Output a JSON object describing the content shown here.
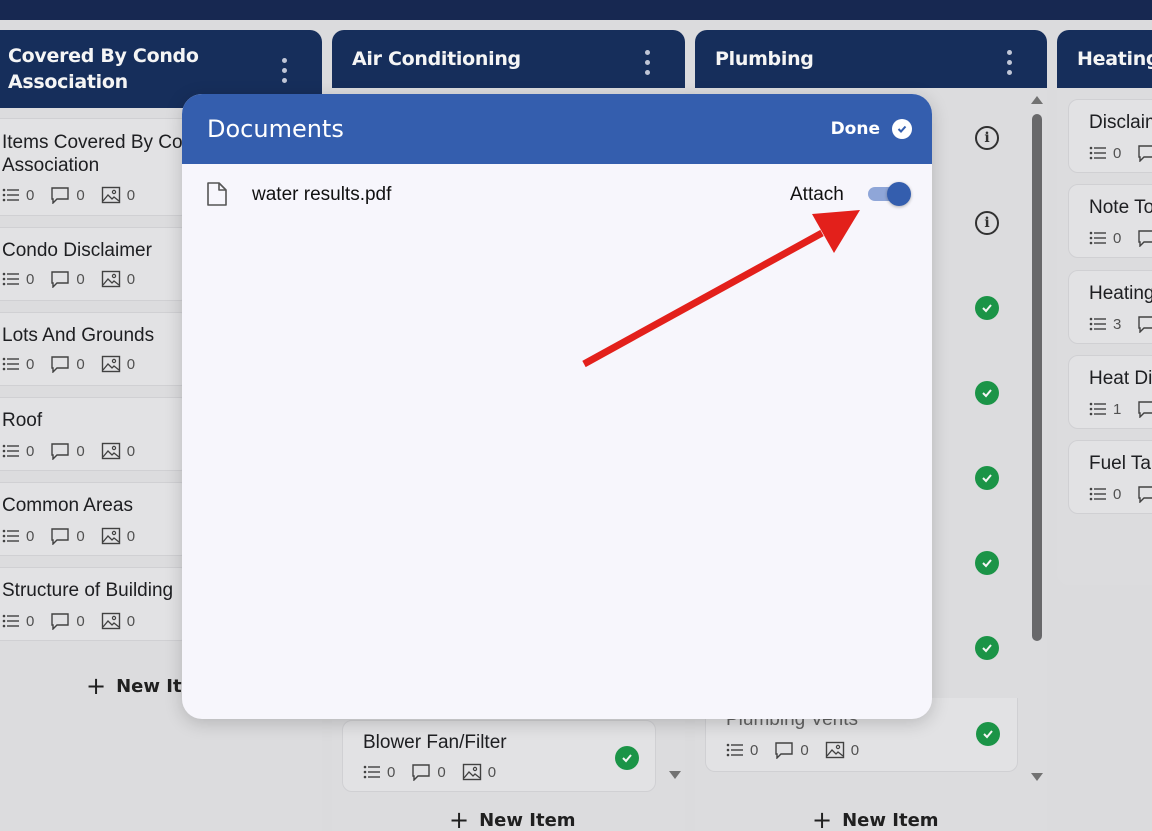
{
  "columns": [
    {
      "title_line1": "Covered By Condo",
      "title_line2": "Association",
      "cards": [
        {
          "title_line1": "Items Covered By Condo",
          "title_line2": "Association",
          "checklist": "0",
          "comments": "0",
          "photos": "0"
        },
        {
          "title": "Condo Disclaimer",
          "checklist": "0",
          "comments": "0",
          "photos": "0"
        },
        {
          "title": "Lots And Grounds",
          "checklist": "0",
          "comments": "0",
          "photos": "0"
        },
        {
          "title": "Roof",
          "checklist": "0",
          "comments": "0",
          "photos": "0"
        },
        {
          "title": "Common Areas",
          "checklist": "0",
          "comments": "0",
          "photos": "0"
        },
        {
          "title": "Structure of Building",
          "checklist": "0",
          "comments": "0",
          "photos": "0"
        }
      ],
      "new_item": "New Item"
    },
    {
      "title": "Air Conditioning",
      "cards": [
        {
          "title": "Blower Fan/Filter",
          "checklist": "0",
          "comments": "0",
          "photos": "0"
        }
      ],
      "new_item": "New Item"
    },
    {
      "title": "Plumbing",
      "cards": [
        {
          "title": "Plumbing Vents",
          "checklist": "0",
          "comments": "0",
          "photos": "0"
        }
      ],
      "new_item": "New Item"
    },
    {
      "title": "Heating",
      "cards": [
        {
          "title": "Disclaimer",
          "checklist": "0"
        },
        {
          "title": "Note To",
          "checklist": "0"
        },
        {
          "title": "Heating",
          "checklist": "3"
        },
        {
          "title": "Heat Di",
          "checklist": "1"
        },
        {
          "title": "Fuel Ta",
          "checklist": "0"
        }
      ]
    }
  ],
  "modal": {
    "title": "Documents",
    "done_label": "Done",
    "documents": [
      {
        "name": "water results.pdf",
        "attach_label": "Attach",
        "attached": true
      }
    ]
  },
  "colors": {
    "header_bg": "#17305f",
    "modal_header": "#345eae",
    "check_green": "#1d9b4a",
    "arrow_red": "#e3201b"
  },
  "icons": {
    "checklist": "list-icon",
    "comments": "comment-icon",
    "photos": "image-icon",
    "document": "file-icon",
    "done": "check-circle-icon",
    "more": "kebab-menu-icon"
  }
}
